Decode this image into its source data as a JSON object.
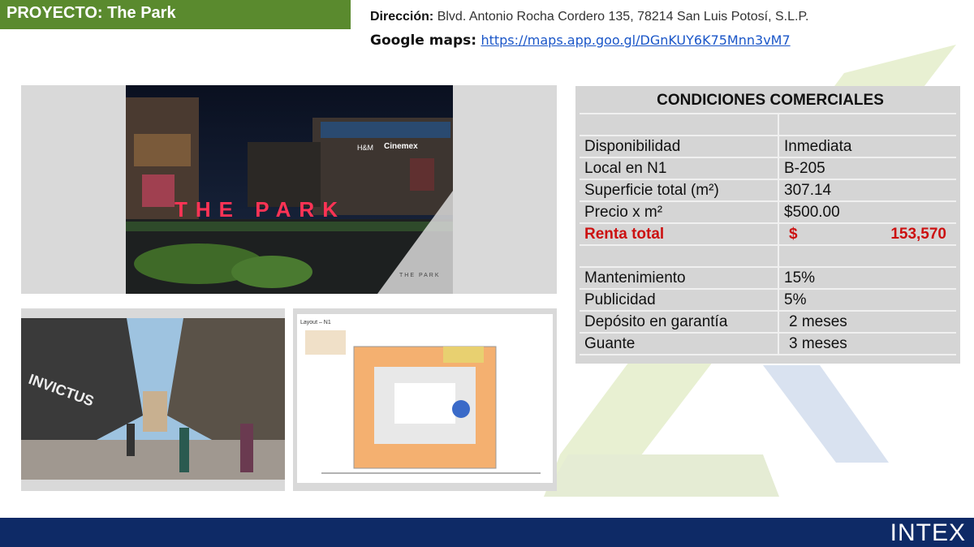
{
  "header": {
    "title": "PROYECTO: The Park"
  },
  "address": {
    "label": "Dirección:",
    "value": "Blvd. Antonio Rocha Cordero 135, 78214 San Luis Potosí, S.L.P."
  },
  "maps": {
    "label": "Google maps:",
    "url": "https://maps.app.goo.gl/DGnKUY6K75Mnn3vM7"
  },
  "photos": {
    "main": {
      "sign_text": "THE PARK",
      "store_hm": "H&M",
      "store_cinemex": "Cinemex",
      "logo_text": "THE PARK"
    },
    "corridor": {
      "store_sign": "INVICTUS"
    },
    "plan": {
      "title": "Layout – N1"
    }
  },
  "conditions": {
    "title": "CONDICIONES COMERCIALES",
    "rows": [
      {
        "label": "Disponibilidad",
        "value": "Inmediata"
      },
      {
        "label": "Local en N1",
        "value": "B-205"
      },
      {
        "label": "Superficie total (m²)",
        "value": "307.14"
      },
      {
        "label": "Precio x m²",
        "value": "$500.00"
      }
    ],
    "total": {
      "label": "Renta total",
      "currency": "$",
      "value": "153,570"
    },
    "extra_rows": [
      {
        "label": "Mantenimiento",
        "value": "15%"
      },
      {
        "label": "Publicidad",
        "value": "5%"
      },
      {
        "label": "Depósito en garantía",
        "value": "2 meses"
      },
      {
        "label": "Guante",
        "value": "3 meses"
      }
    ]
  },
  "footer": {
    "logo": "INTEX"
  },
  "colors": {
    "header_green": "#5a8a2e",
    "footer_navy": "#0e2a66",
    "total_red": "#cc1111",
    "link_blue": "#1a56c8"
  }
}
